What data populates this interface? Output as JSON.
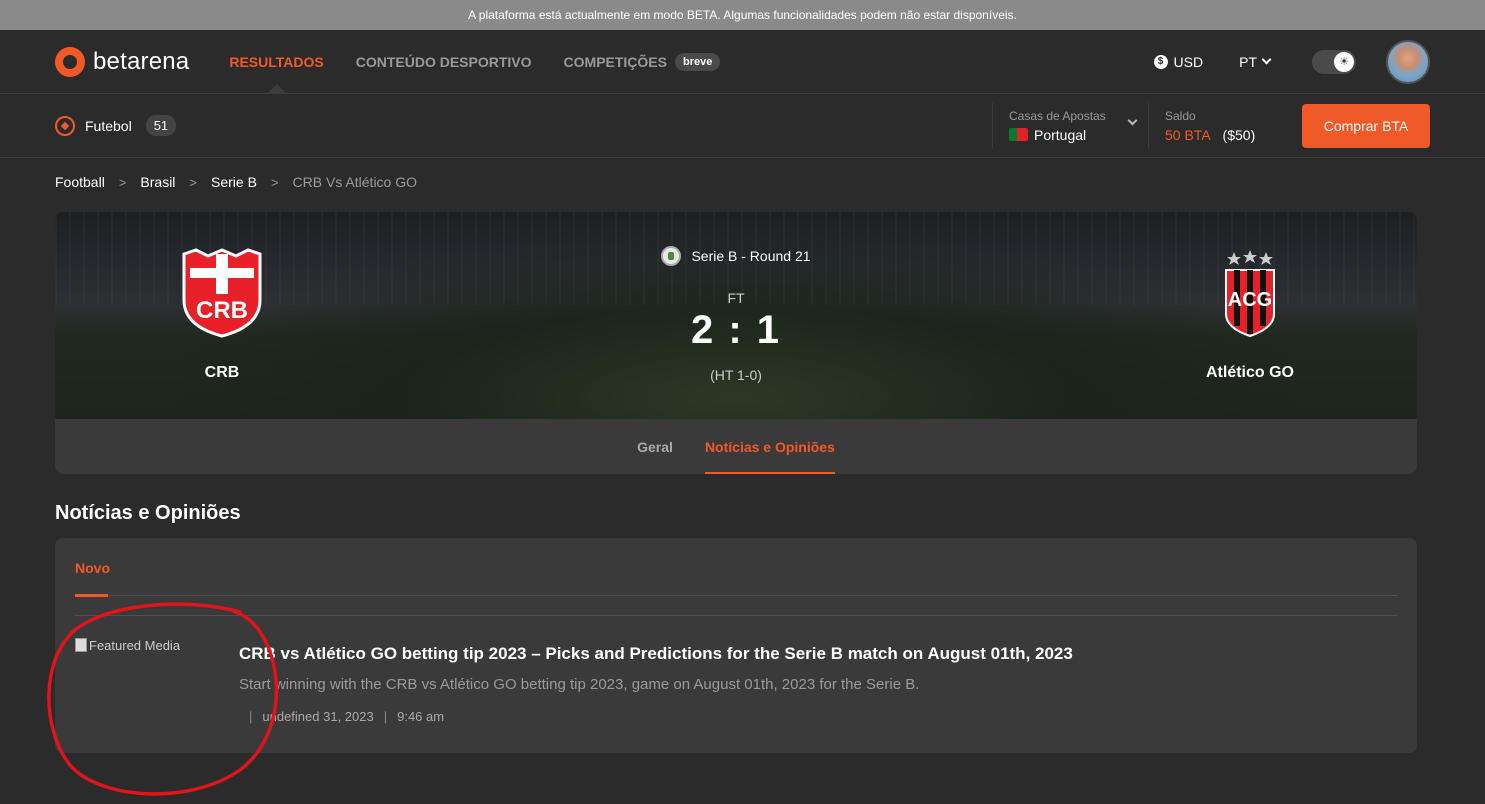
{
  "beta_banner": "A plataforma está actualmente em modo BETA. Algumas funcionalidades podem não estar disponíveis.",
  "brand": {
    "name": "betarena",
    "accent_color": "#f05a28"
  },
  "nav": {
    "links": [
      {
        "label": "RESULTADOS",
        "active": true
      },
      {
        "label": "CONTEÚDO DESPORTIVO",
        "active": false
      },
      {
        "label": "COMPETIÇÕES",
        "active": false,
        "badge": "breve"
      }
    ],
    "currency": "USD",
    "language": "PT"
  },
  "subnav": {
    "sport": "Futebol",
    "sport_count": "51",
    "bookmakers_label": "Casas de Apostas",
    "bookmakers_value": "Portugal",
    "balance_label": "Saldo",
    "balance_bta": "50 BTA",
    "balance_usd": "($50)",
    "buy_button": "Comprar BTA"
  },
  "breadcrumb": [
    "Football",
    "Brasil",
    "Serie B",
    "CRB Vs Atlético GO"
  ],
  "match": {
    "round": "Serie B - Round 21",
    "status": "FT",
    "score": "2 : 1",
    "halftime": "(HT 1-0)",
    "home_team": "CRB",
    "away_team": "Atlético GO",
    "home_crest_text": "CRB",
    "away_crest_text": "ACG",
    "tabs": [
      {
        "label": "Geral",
        "active": false
      },
      {
        "label": "Notícias e Opiniões",
        "active": true
      }
    ]
  },
  "news": {
    "section_title": "Notícias e Opiniões",
    "tab": "Novo",
    "articles": [
      {
        "image_alt": "Featured Media",
        "title": "CRB vs Atlético GO betting tip 2023 – Picks and Predictions for the Serie B match on August 01th, 2023",
        "description": "Start winning with the CRB vs Atlético GO betting tip 2023, game on August 01th, 2023 for the Serie B.",
        "date": "undefined 31, 2023",
        "time": "9:46 am"
      }
    ]
  }
}
